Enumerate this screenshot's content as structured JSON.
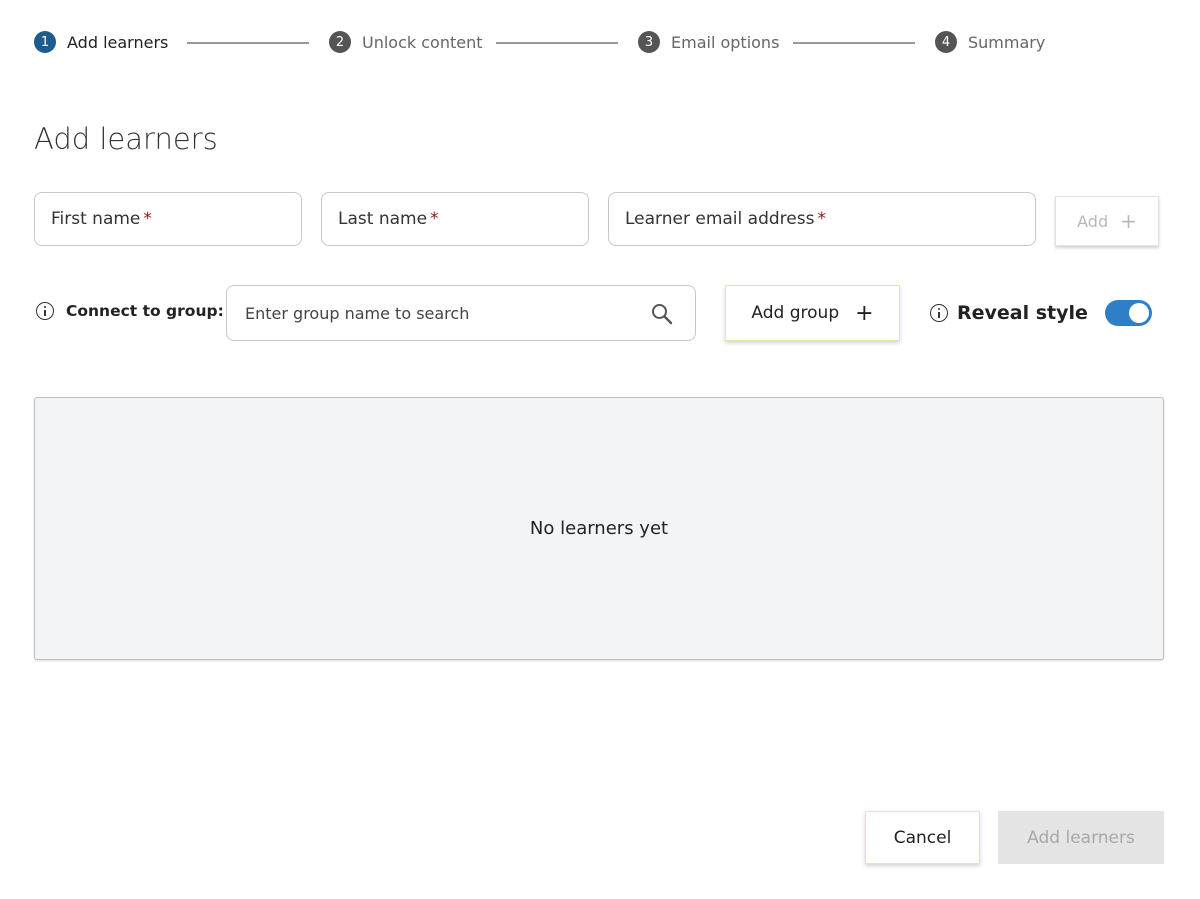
{
  "stepper": {
    "steps": [
      {
        "number": "1",
        "label": "Add learners",
        "active": true
      },
      {
        "number": "2",
        "label": "Unlock content",
        "active": false
      },
      {
        "number": "3",
        "label": "Email options",
        "active": false
      },
      {
        "number": "4",
        "label": "Summary",
        "active": false
      }
    ]
  },
  "page_title": "Add learners",
  "form": {
    "first_name_label": "First name",
    "last_name_label": "Last name",
    "email_label": "Learner email address",
    "required_marker": "*",
    "add_label": "Add",
    "add_symbol": "+"
  },
  "group": {
    "connect_label": "Connect to group:",
    "search_placeholder": "Enter group name to search",
    "add_group_label": "Add group",
    "add_group_symbol": "+"
  },
  "reveal": {
    "label": "Reveal style",
    "enabled": true
  },
  "learners": {
    "empty_text": "No learners yet"
  },
  "footer": {
    "cancel_label": "Cancel",
    "submit_label": "Add learners"
  },
  "colors": {
    "active_step": "#1d5c8f",
    "inactive_step": "#555555",
    "toggle_on": "#2f7fc8",
    "required": "#8b1a1a",
    "panel_bg": "#f3f4f6"
  },
  "icons": {
    "info": "info-icon",
    "search": "search-icon",
    "plus": "plus-icon"
  }
}
